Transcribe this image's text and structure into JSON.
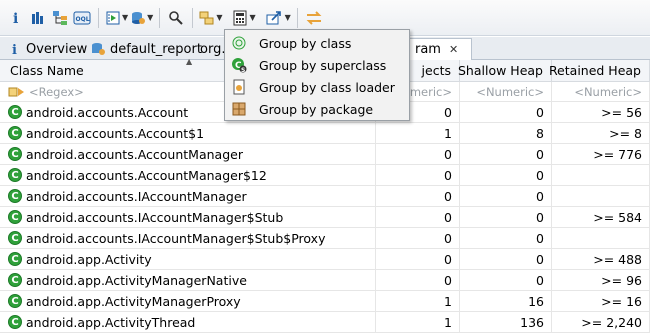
{
  "tabs": [
    {
      "label": "Overview",
      "icon": "info-icon"
    },
    {
      "label": "default_report",
      "icon": "report-gear-icon"
    },
    {
      "label": "org.",
      "icon": ""
    },
    {
      "label": "ram",
      "icon": ""
    }
  ],
  "columns": [
    "Class Name",
    "Objects",
    "Shallow Heap",
    "Retained Heap"
  ],
  "column_header_partial": "jects",
  "filter_row": {
    "class_name": "<Regex>",
    "objects": "umeric>",
    "shallow": "<Numeric>",
    "retained": "<Numeric>"
  },
  "rows": [
    {
      "name": "android.accounts.Account",
      "objects": "0",
      "shallow": "0",
      "retained": ">= 56"
    },
    {
      "name": "android.accounts.Account$1",
      "objects": "1",
      "shallow": "8",
      "retained": ">= 8"
    },
    {
      "name": "android.accounts.AccountManager",
      "objects": "0",
      "shallow": "0",
      "retained": ">= 776"
    },
    {
      "name": "android.accounts.AccountManager$12",
      "objects": "0",
      "shallow": "0",
      "retained": ""
    },
    {
      "name": "android.accounts.IAccountManager",
      "objects": "0",
      "shallow": "0",
      "retained": ""
    },
    {
      "name": "android.accounts.IAccountManager$Stub",
      "objects": "0",
      "shallow": "0",
      "retained": ">= 584"
    },
    {
      "name": "android.accounts.IAccountManager$Stub$Proxy",
      "objects": "0",
      "shallow": "0",
      "retained": ""
    },
    {
      "name": "android.app.Activity",
      "objects": "0",
      "shallow": "0",
      "retained": ">= 488"
    },
    {
      "name": "android.app.ActivityManagerNative",
      "objects": "0",
      "shallow": "0",
      "retained": ">= 96"
    },
    {
      "name": "android.app.ActivityManagerProxy",
      "objects": "1",
      "shallow": "16",
      "retained": ">= 16"
    },
    {
      "name": "android.app.ActivityThread",
      "objects": "1",
      "shallow": "136",
      "retained": ">= 2,240"
    }
  ],
  "menu": [
    {
      "label": "Group by class",
      "icon": "group-class-icon"
    },
    {
      "label": "Group by superclass",
      "icon": "group-superclass-icon"
    },
    {
      "label": "Group by class loader",
      "icon": "group-classloader-icon"
    },
    {
      "label": "Group by package",
      "icon": "group-package-icon"
    }
  ],
  "class_icon_letter": "C",
  "colors": {
    "class_icon": "#2fa13a",
    "toolbar_icon_blue": "#1f5fa6",
    "accent_orange": "#e8a33a"
  }
}
